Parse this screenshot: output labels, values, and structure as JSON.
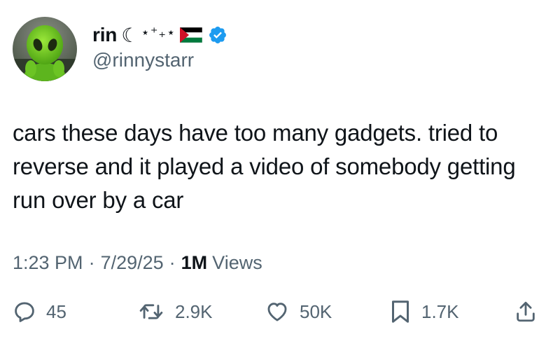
{
  "user": {
    "display_name": "rin",
    "decor_moon": "☾",
    "decor_stars": "⋆⁺₊⋆",
    "flag_icon": "palestine-flag-icon",
    "verified_icon": "verified-badge-icon",
    "handle": "@rinnystarr",
    "avatar_icon": "green-alien-plush-avatar"
  },
  "tweet": {
    "text": "cars these days have too many gadgets. tried to reverse and it played a video of somebody getting run over by a car"
  },
  "meta": {
    "time": "1:23 PM",
    "separator": "·",
    "date": "7/29/25",
    "views_count": "1M",
    "views_label": "Views"
  },
  "actions": {
    "replies": "45",
    "retweets": "2.9K",
    "likes": "50K",
    "bookmarks": "1.7K"
  },
  "colors": {
    "text": "#0f1419",
    "secondary": "#536471",
    "verified": "#1d9bf0",
    "background": "#ffffff"
  }
}
